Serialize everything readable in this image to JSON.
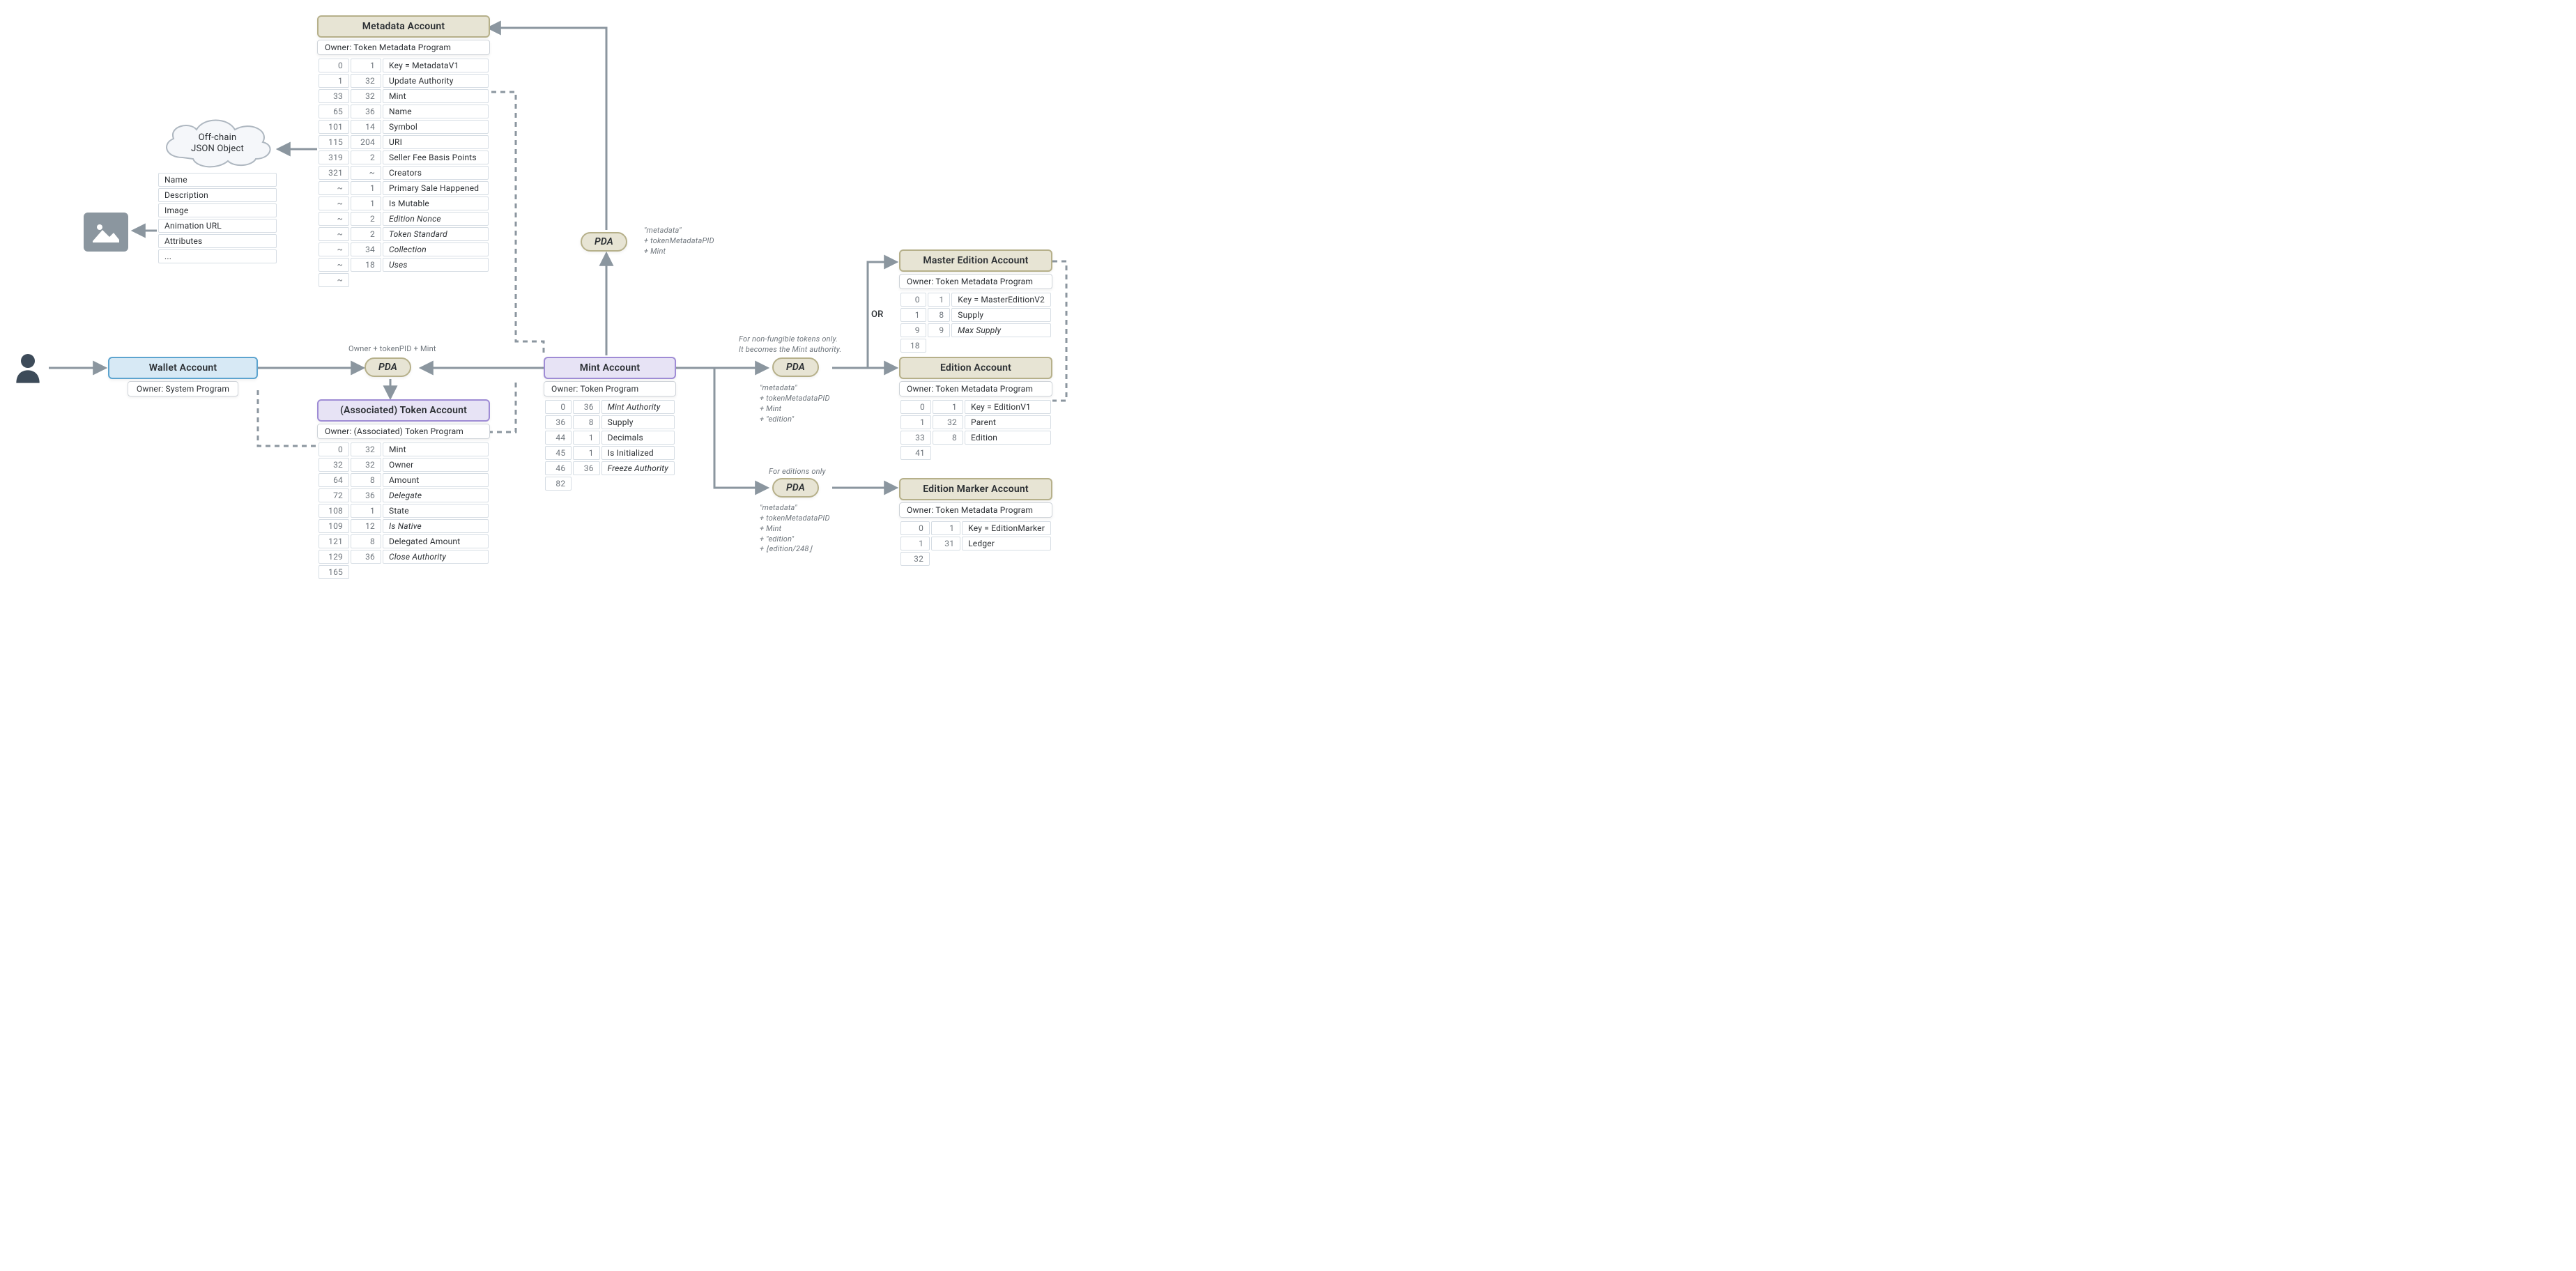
{
  "icons": {
    "user": "user-icon",
    "image": "image-icon"
  },
  "wallet": {
    "title": "Wallet Account",
    "owner": "Owner: System Program"
  },
  "cloud": {
    "line1": "Off-chain",
    "line2": "JSON Object",
    "fields": [
      "Name",
      "Description",
      "Image",
      "Animation URL",
      "Attributes",
      "..."
    ]
  },
  "pda_ata": {
    "label": "PDA",
    "seeds": "Owner + tokenPID + Mint"
  },
  "token_account": {
    "title": "(Associated) Token Account",
    "owner": "Owner: (Associated) Token Program",
    "rows": [
      {
        "off": "0",
        "sz": "32",
        "name": "Mint"
      },
      {
        "off": "32",
        "sz": "32",
        "name": "Owner"
      },
      {
        "off": "64",
        "sz": "8",
        "name": "Amount"
      },
      {
        "off": "72",
        "sz": "36",
        "name": "Delegate",
        "ital": true
      },
      {
        "off": "108",
        "sz": "1",
        "name": "State"
      },
      {
        "off": "109",
        "sz": "12",
        "name": "Is Native",
        "ital": true
      },
      {
        "off": "121",
        "sz": "8",
        "name": "Delegated Amount"
      },
      {
        "off": "129",
        "sz": "36",
        "name": "Close Authority",
        "ital": true
      },
      {
        "off": "165",
        "sz": "",
        "name": ""
      }
    ]
  },
  "metadata": {
    "title": "Metadata Account",
    "owner": "Owner: Token Metadata Program",
    "rows": [
      {
        "off": "0",
        "sz": "1",
        "name": "Key = MetadataV1"
      },
      {
        "off": "1",
        "sz": "32",
        "name": "Update Authority"
      },
      {
        "off": "33",
        "sz": "32",
        "name": "Mint"
      },
      {
        "off": "65",
        "sz": "36",
        "name": "Name"
      },
      {
        "off": "101",
        "sz": "14",
        "name": "Symbol"
      },
      {
        "off": "115",
        "sz": "204",
        "name": "URI"
      },
      {
        "off": "319",
        "sz": "2",
        "name": "Seller Fee Basis Points"
      },
      {
        "off": "321",
        "sz": "~",
        "name": "Creators"
      },
      {
        "off": "~",
        "sz": "1",
        "name": "Primary Sale Happened"
      },
      {
        "off": "~",
        "sz": "1",
        "name": "Is Mutable"
      },
      {
        "off": "~",
        "sz": "2",
        "name": "Edition Nonce",
        "ital": true
      },
      {
        "off": "~",
        "sz": "2",
        "name": "Token Standard",
        "ital": true
      },
      {
        "off": "~",
        "sz": "34",
        "name": "Collection",
        "ital": true
      },
      {
        "off": "~",
        "sz": "18",
        "name": "Uses",
        "ital": true
      },
      {
        "off": "~",
        "sz": "",
        "name": ""
      }
    ]
  },
  "mint": {
    "title": "Mint Account",
    "owner": "Owner: Token Program",
    "rows": [
      {
        "off": "0",
        "sz": "36",
        "name": "Mint Authority",
        "ital": true
      },
      {
        "off": "36",
        "sz": "8",
        "name": "Supply"
      },
      {
        "off": "44",
        "sz": "1",
        "name": "Decimals"
      },
      {
        "off": "45",
        "sz": "1",
        "name": "Is Initialized"
      },
      {
        "off": "46",
        "sz": "36",
        "name": "Freeze Authority",
        "ital": true
      },
      {
        "off": "82",
        "sz": "",
        "name": ""
      }
    ]
  },
  "pda_meta": {
    "label": "PDA",
    "seeds": "\"metadata\"\n+ tokenMetadataPID\n+ Mint"
  },
  "pda_edition": {
    "label": "PDA",
    "note": "For non-fungible tokens only.\nIt becomes the Mint authority.",
    "seeds": "\"metadata\"\n+ tokenMetadataPID\n+ Mint\n+ \"edition\""
  },
  "pda_marker": {
    "label": "PDA",
    "note": "For editions only",
    "seeds": "\"metadata\"\n+ tokenMetadataPID\n+ Mint\n+ \"edition\"\n+ ⌊edition/248⌋"
  },
  "master": {
    "title": "Master Edition Account",
    "owner": "Owner: Token Metadata Program",
    "rows": [
      {
        "off": "0",
        "sz": "1",
        "name": "Key = MasterEditionV2"
      },
      {
        "off": "1",
        "sz": "8",
        "name": "Supply"
      },
      {
        "off": "9",
        "sz": "9",
        "name": "Max Supply",
        "ital": true
      },
      {
        "off": "18",
        "sz": "",
        "name": ""
      }
    ]
  },
  "edition": {
    "title": "Edition Account",
    "owner": "Owner: Token Metadata Program",
    "rows": [
      {
        "off": "0",
        "sz": "1",
        "name": "Key = EditionV1"
      },
      {
        "off": "1",
        "sz": "32",
        "name": "Parent"
      },
      {
        "off": "33",
        "sz": "8",
        "name": "Edition"
      },
      {
        "off": "41",
        "sz": "",
        "name": ""
      }
    ]
  },
  "marker": {
    "title": "Edition Marker Account",
    "owner": "Owner: Token Metadata Program",
    "rows": [
      {
        "off": "0",
        "sz": "1",
        "name": "Key = EditionMarker"
      },
      {
        "off": "1",
        "sz": "31",
        "name": "Ledger"
      },
      {
        "off": "32",
        "sz": "",
        "name": ""
      }
    ]
  },
  "or_label": "OR"
}
